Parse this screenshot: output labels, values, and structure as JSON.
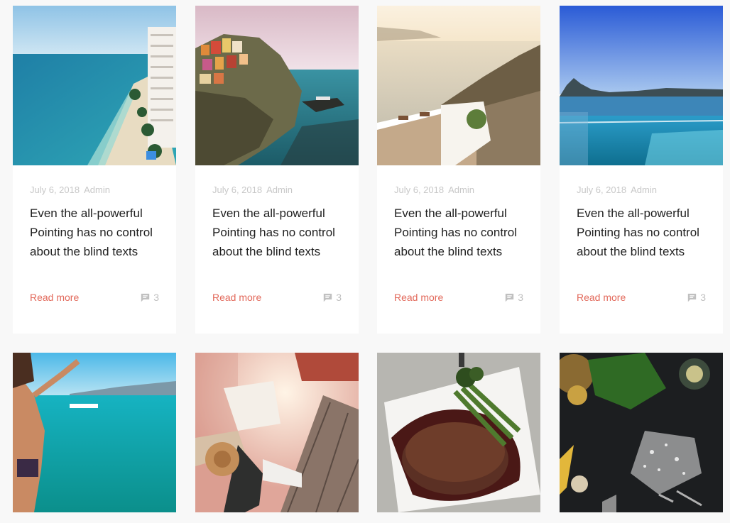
{
  "posts": [
    {
      "date": "July 6, 2018",
      "author": "Admin",
      "title": "Even the all-powerful Pointing has no control about the blind texts",
      "read_more": "Read more",
      "comments": "3",
      "image": "beach-highrise-photo"
    },
    {
      "date": "July 6, 2018",
      "author": "Admin",
      "title": "Even the all-powerful Pointing has no control about the blind texts",
      "read_more": "Read more",
      "comments": "3",
      "image": "cliff-village-photo"
    },
    {
      "date": "July 6, 2018",
      "author": "Admin",
      "title": "Even the all-powerful Pointing has no control about the blind texts",
      "read_more": "Read more",
      "comments": "3",
      "image": "terrace-sea-photo"
    },
    {
      "date": "July 6, 2018",
      "author": "Admin",
      "title": "Even the all-powerful Pointing has no control about the blind texts",
      "read_more": "Read more",
      "comments": "3",
      "image": "infinity-pool-photo"
    }
  ],
  "row2_images": [
    "girl-jumping-sea-photo",
    "traveler-map-railway-photo",
    "steak-plate-photo",
    "flour-dark-table-photo"
  ]
}
